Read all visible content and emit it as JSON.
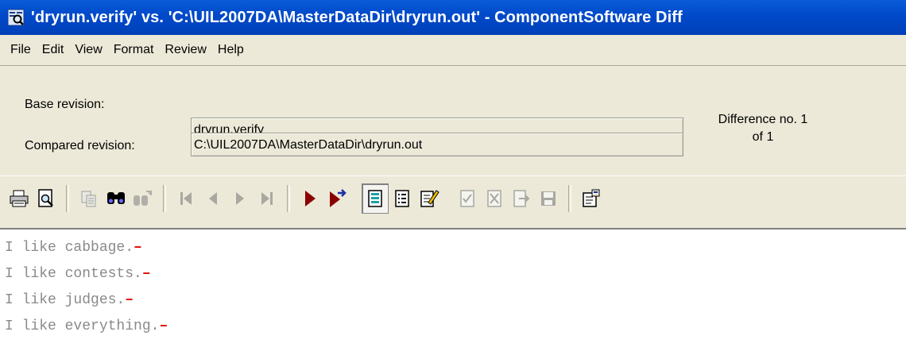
{
  "window": {
    "title": "'dryrun.verify' vs. 'C:\\UIL2007DA\\MasterDataDir\\dryrun.out' - ComponentSoftware Diff",
    "app_icon": "diff-magnifier-icon"
  },
  "menu": [
    "File",
    "Edit",
    "View",
    "Format",
    "Review",
    "Help"
  ],
  "revisions": {
    "base_label": "Base revision:",
    "base_value": "dryrun.verify",
    "compared_label": "Compared revision:",
    "compared_value": "C:\\UIL2007DA\\MasterDataDir\\dryrun.out",
    "difference_line1": "Difference no. 1",
    "difference_line2": "of 1"
  },
  "toolbar": {
    "icons": [
      "print-icon",
      "print-preview-icon",
      "copy-icon",
      "find-icon",
      "find-next-icon",
      "first-difference-icon",
      "previous-difference-icon",
      "next-difference-icon",
      "last-difference-icon",
      "play-icon",
      "step-next-icon",
      "view-both-icon",
      "view-list-icon",
      "edit-note-icon",
      "accept-icon",
      "reject-icon",
      "export-icon",
      "save-icon",
      "properties-icon"
    ]
  },
  "content": {
    "lines": [
      "I like cabbage.",
      "I like contests.",
      "I like judges.",
      "I like everything."
    ],
    "eol_marker": "–",
    "eol_color": "#e00000"
  }
}
